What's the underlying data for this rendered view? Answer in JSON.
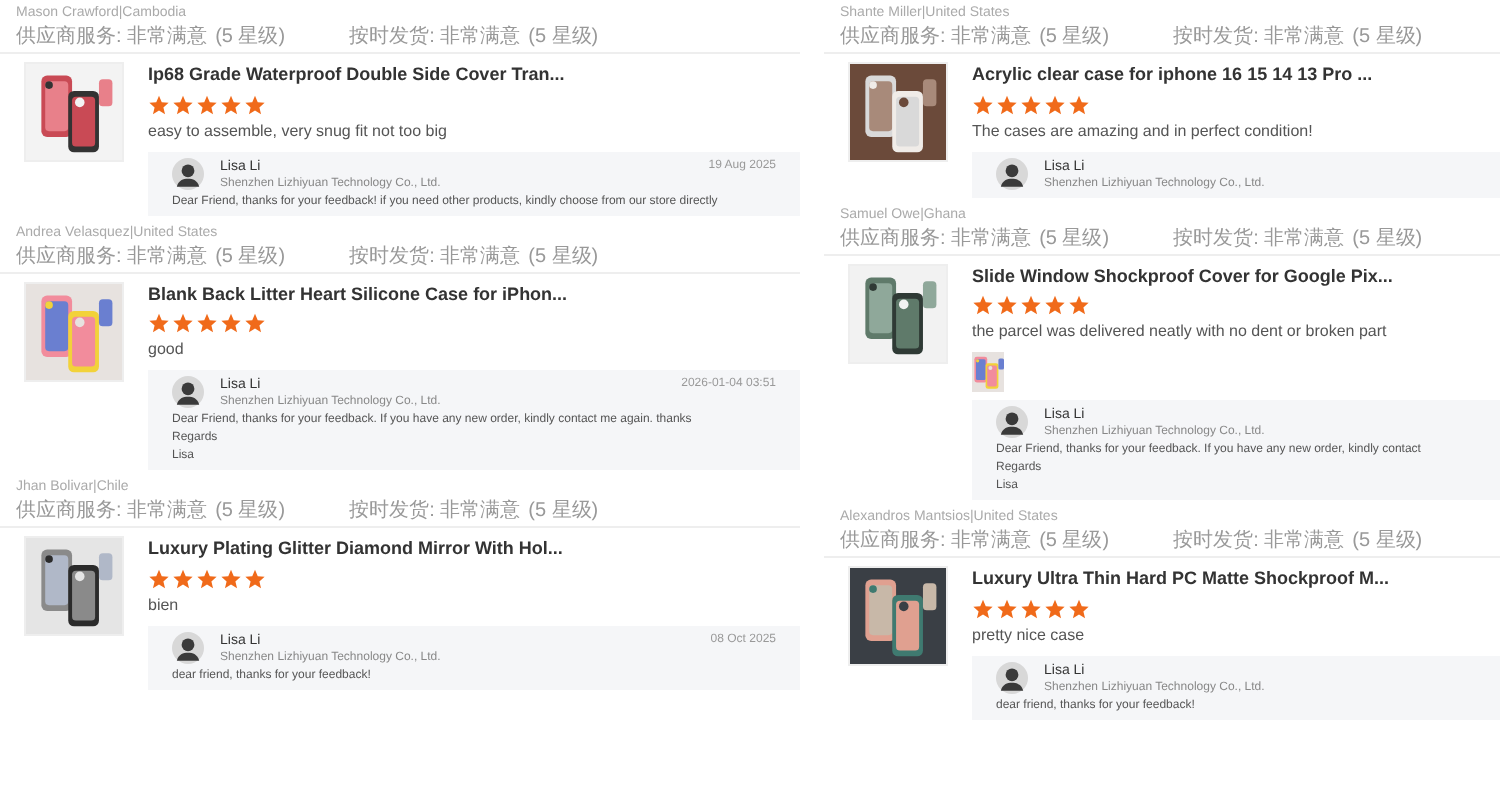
{
  "columns": [
    {
      "reviews": [
        {
          "reviewer": "Mason Crawford|Cambodia",
          "ratings": [
            {
              "label": "供应商服务: 非常满意",
              "note": "(5 星级)"
            },
            {
              "label": "按时发货: 非常满意",
              "note": "(5 星级)"
            }
          ],
          "product": {
            "title": "Ip68 Grade Waterproof Double Side Cover Tran...",
            "image": {
              "kind": "picture"
            }
          },
          "stars": 5,
          "comment": "easy to assemble, very snug fit not too big",
          "reply": {
            "name": "Lisa Li",
            "company": "Shenzhen Lizhiyuan Technology Co., Ltd.",
            "date": "19 Aug 2025",
            "lines": [
              "Dear Friend, thanks for your feedback! if you need other products, kindly choose  from our store directly"
            ]
          }
        },
        {
          "reviewer": "Andrea Velasquez|United States",
          "ratings": [
            {
              "label": "供应商服务: 非常满意",
              "note": "(5 星级)"
            },
            {
              "label": "按时发货: 非常满意",
              "note": "(5 星级)"
            }
          ],
          "product": {
            "title": "Blank Back Litter Heart Silicone Case for iPhon...",
            "image": {
              "kind": "picture"
            }
          },
          "stars": 5,
          "comment": "good",
          "reply": {
            "name": "Lisa Li",
            "company": "Shenzhen Lizhiyuan Technology Co., Ltd.",
            "date": "2026-01-04 03:51",
            "lines": [
              "Dear Friend, thanks for your feedback. If you have any new order, kindly contact me again. thanks",
              "Regards",
              "Lisa"
            ]
          }
        },
        {
          "reviewer": "Jhan Bolivar|Chile",
          "ratings": [
            {
              "label": "供应商服务: 非常满意",
              "note": "(5 星级)"
            },
            {
              "label": "按时发货: 非常满意",
              "note": "(5 星级)"
            }
          ],
          "product": {
            "title": "Luxury Plating Glitter Diamond Mirror With Hol...",
            "image": {
              "kind": "picture"
            }
          },
          "stars": 5,
          "comment": "bien",
          "reply": {
            "name": "Lisa Li",
            "company": "Shenzhen Lizhiyuan Technology Co., Ltd.",
            "date": "08 Oct 2025",
            "lines": [
              "dear friend, thanks for your feedback!"
            ]
          }
        }
      ]
    },
    {
      "reviews": [
        {
          "reviewer": "Shante Miller|United States",
          "ratings": [
            {
              "label": "供应商服务: 非常满意",
              "note": "(5 星级)"
            },
            {
              "label": "按时发货: 非常满意",
              "note": "(5 星级)"
            }
          ],
          "product": {
            "title": "Acrylic clear case for iphone 16 15 14 13 Pro ...",
            "image": {
              "kind": "picture"
            }
          },
          "stars": 5,
          "comment": "The cases are amazing and in perfect condition!",
          "reply": {
            "name": "Lisa Li",
            "company": "Shenzhen Lizhiyuan Technology Co., Ltd."
          }
        },
        {
          "reviewer": "Samuel Owe|Ghana",
          "ratings": [
            {
              "label": "供应商服务: 非常满意",
              "note": "(5 星级)"
            },
            {
              "label": "按时发货: 非常满意",
              "note": "(5 星级)"
            }
          ],
          "product": {
            "title": "Slide Window Shockproof Cover for Google Pix...",
            "image": {
              "kind": "picture"
            }
          },
          "stars": 5,
          "comment": "the parcel was delivered neatly with no dent or broken part",
          "photos": [
            {
              "kind": "picture"
            }
          ],
          "reply": {
            "name": "Lisa Li",
            "company": "Shenzhen Lizhiyuan Technology Co., Ltd.",
            "lines": [
              "Dear Friend, thanks for your feedback. If you have any new order, kindly contact",
              "Regards",
              "Lisa"
            ]
          }
        },
        {
          "reviewer": "Alexandros Mantsios|United States",
          "ratings": [
            {
              "label": "供应商服务: 非常满意",
              "note": "(5 星级)"
            },
            {
              "label": "按时发货: 非常满意",
              "note": "(5 星级)"
            }
          ],
          "product": {
            "title": "Luxury Ultra Thin Hard PC Matte Shockproof M...",
            "image": {
              "kind": "picture"
            }
          },
          "stars": 5,
          "comment": "pretty nice case",
          "reply": {
            "name": "Lisa Li",
            "company": "Shenzhen Lizhiyuan Technology Co., Ltd.",
            "lines": [
              "dear friend, thanks for your feedback!"
            ]
          }
        }
      ]
    }
  ]
}
